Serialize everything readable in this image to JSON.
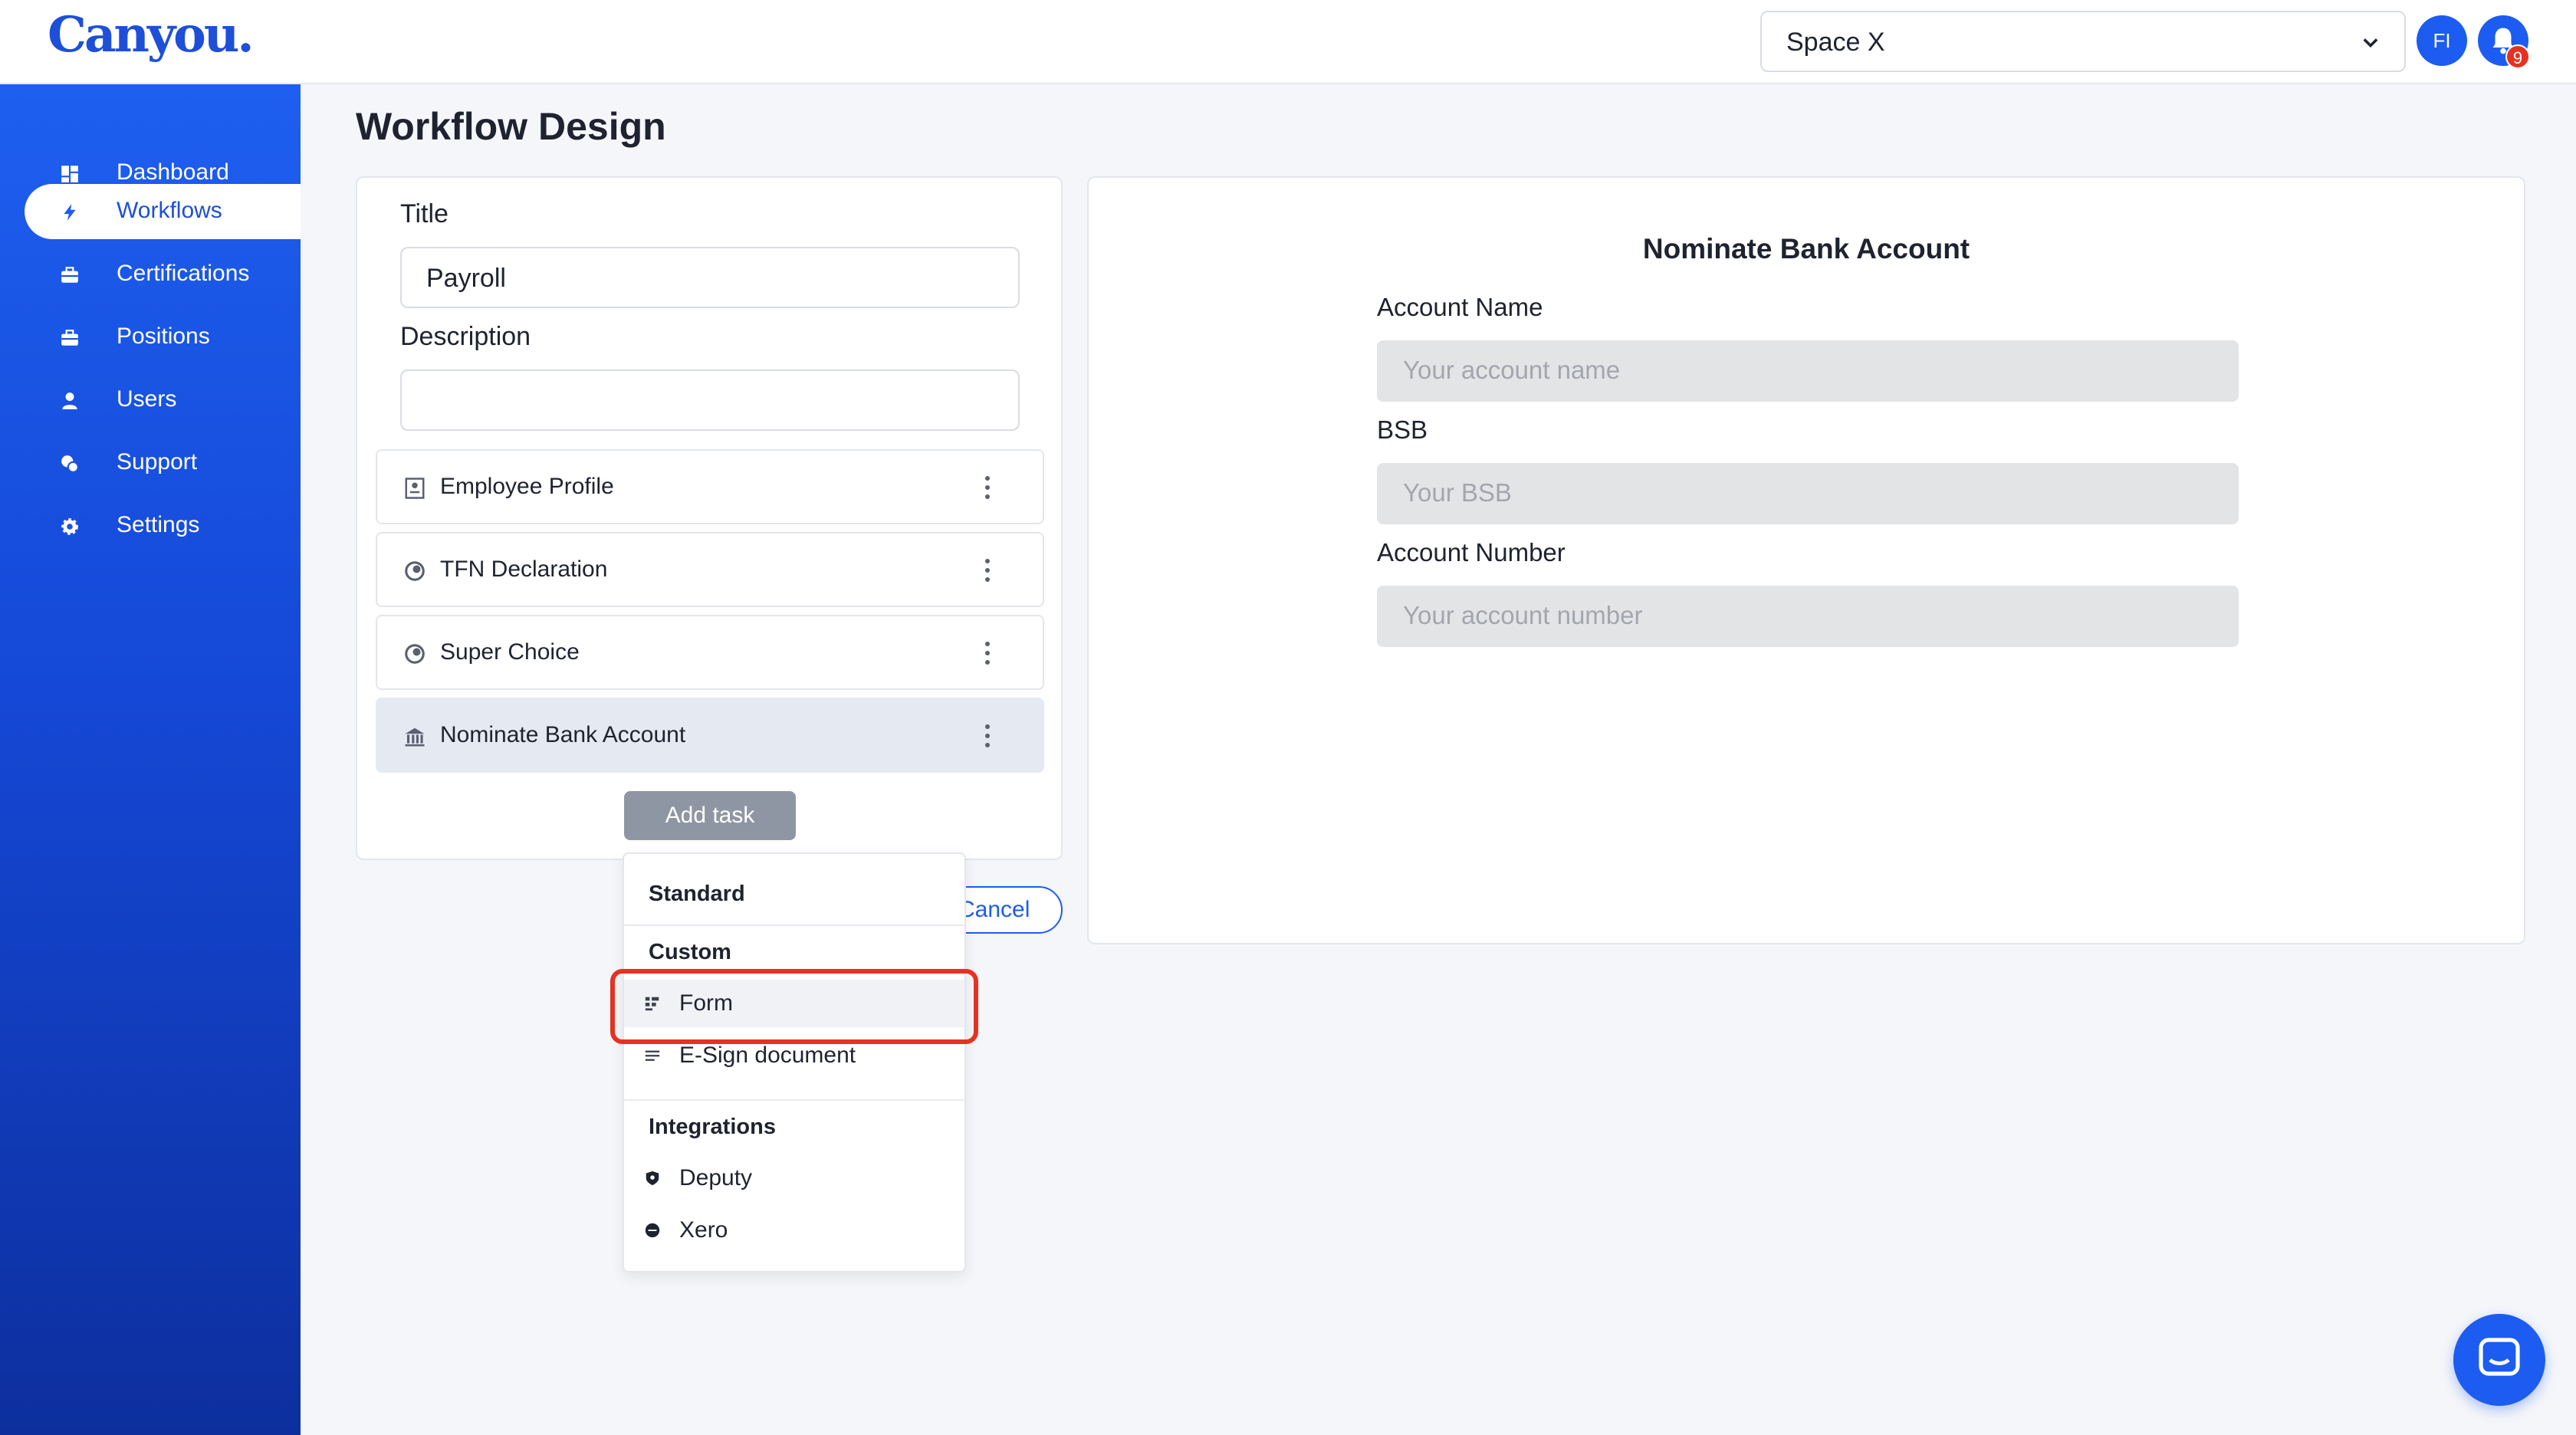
{
  "header": {
    "logo": "Canyou.",
    "space_select": "Space X",
    "avatar_initials": "FI",
    "notification_count": "9"
  },
  "sidebar": {
    "items": [
      {
        "label": "Dashboard",
        "icon": "dashboard-icon"
      },
      {
        "label": "Workflows",
        "icon": "lightning-icon",
        "active": true
      },
      {
        "label": "Certifications",
        "icon": "briefcase-icon"
      },
      {
        "label": "Positions",
        "icon": "briefcase-icon"
      },
      {
        "label": "Users",
        "icon": "user-icon"
      },
      {
        "label": "Support",
        "icon": "support-icon"
      },
      {
        "label": "Settings",
        "icon": "gear-icon"
      }
    ]
  },
  "main": {
    "page_title": "Workflow Design",
    "form": {
      "title_label": "Title",
      "title_value": "Payroll",
      "description_label": "Description",
      "description_value": ""
    },
    "tasks": [
      {
        "label": "Employee Profile",
        "icon": "profile-doc-icon"
      },
      {
        "label": "TFN Declaration",
        "icon": "ato-icon"
      },
      {
        "label": "Super Choice",
        "icon": "ato-icon"
      },
      {
        "label": "Nominate Bank Account",
        "icon": "bank-icon",
        "selected": true
      }
    ],
    "add_task_label": "Add task",
    "cancel_label": "Cancel",
    "add_menu": {
      "standard_heading": "Standard",
      "custom_heading": "Custom",
      "custom_items": [
        {
          "label": "Form",
          "icon": "form-icon"
        },
        {
          "label": "E-Sign document",
          "icon": "document-icon"
        }
      ],
      "integrations_heading": "Integrations",
      "integration_items": [
        {
          "label": "Deputy",
          "icon": "deputy-icon"
        },
        {
          "label": "Xero",
          "icon": "xero-icon"
        }
      ]
    }
  },
  "preview": {
    "title": "Nominate Bank Account",
    "fields": [
      {
        "label": "Account Name",
        "placeholder": "Your account name"
      },
      {
        "label": "BSB",
        "placeholder": "Your BSB"
      },
      {
        "label": "Account Number",
        "placeholder": "Your account number"
      }
    ]
  },
  "colors": {
    "brand": "#1d5cf0",
    "highlight": "#e53222"
  }
}
